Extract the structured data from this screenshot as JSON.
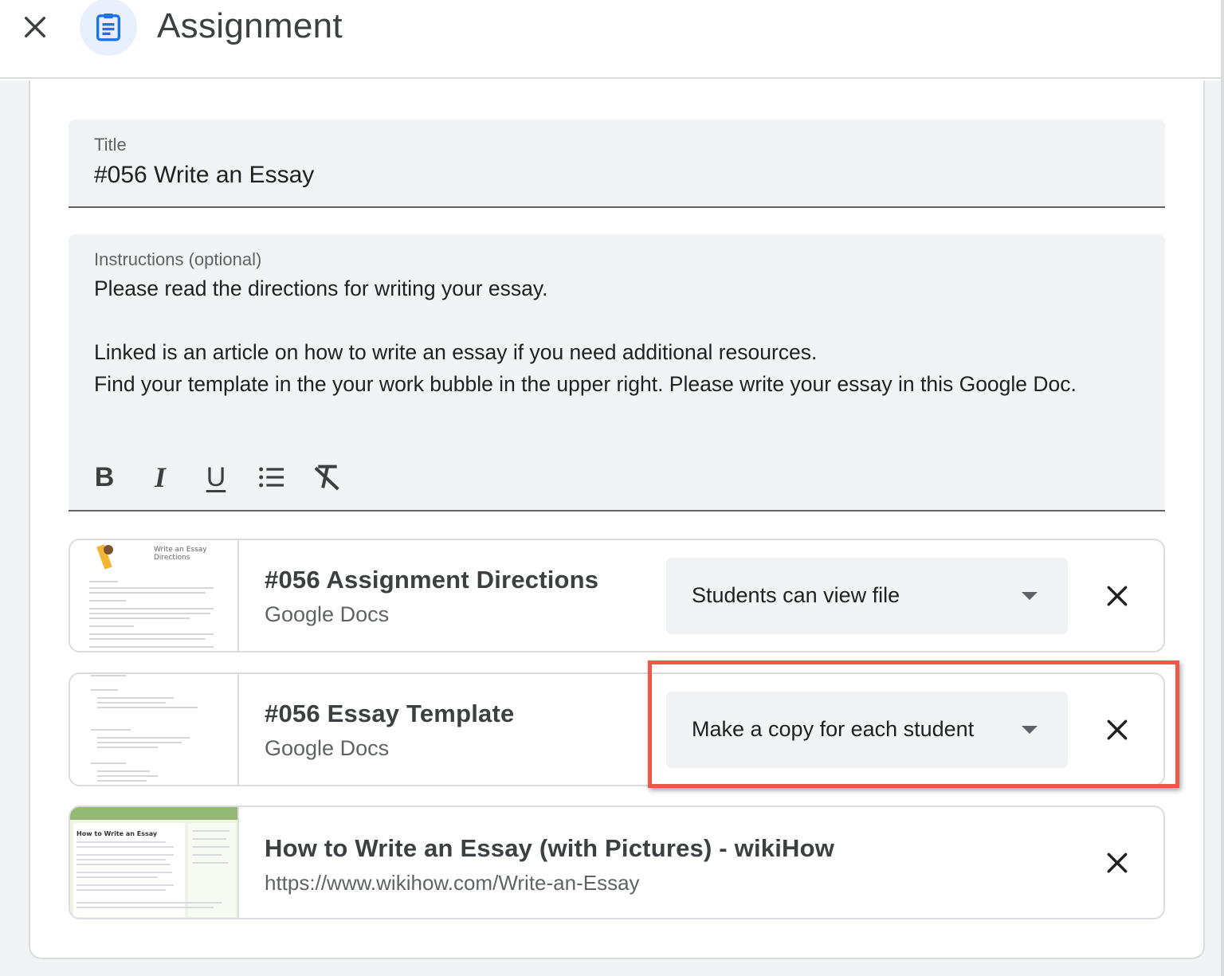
{
  "header": {
    "title": "Assignment",
    "close_icon": "close-icon",
    "assignment_icon": "assignment-clipboard-icon",
    "accent_color": "#1a73e8"
  },
  "title_field": {
    "label": "Title",
    "value": "#056 Write an Essay"
  },
  "instructions_field": {
    "label": "Instructions (optional)",
    "paragraphs": [
      "Please read the directions for writing your essay.",
      "",
      "Linked is an article on how to write an essay if you need additional resources.",
      "Find your template in the your work bubble in the upper right. Please write your essay in this Google Doc."
    ],
    "toolbar": [
      {
        "name": "bold",
        "glyph": "B"
      },
      {
        "name": "italic",
        "glyph": "I"
      },
      {
        "name": "underline",
        "glyph": "U"
      },
      {
        "name": "bulleted-list",
        "icon": "bulleted-list-icon"
      },
      {
        "name": "clear-formatting",
        "icon": "clear-formatting-icon"
      }
    ]
  },
  "attachments": [
    {
      "title": "#056 Assignment Directions",
      "subtitle": "Google Docs",
      "thumb_heading": "Write an Essay\nDirections",
      "permission": "Students can view file"
    },
    {
      "title": "#056 Essay Template",
      "subtitle": "Google Docs",
      "permission": "Make a copy for each student",
      "highlighted": true,
      "highlight_color": "#f0574b"
    },
    {
      "title": "How to Write an Essay (with Pictures) - wikiHow",
      "subtitle": "https://www.wikihow.com/Write-an-Essay",
      "thumb_heading": "How to Write an Essay"
    }
  ]
}
